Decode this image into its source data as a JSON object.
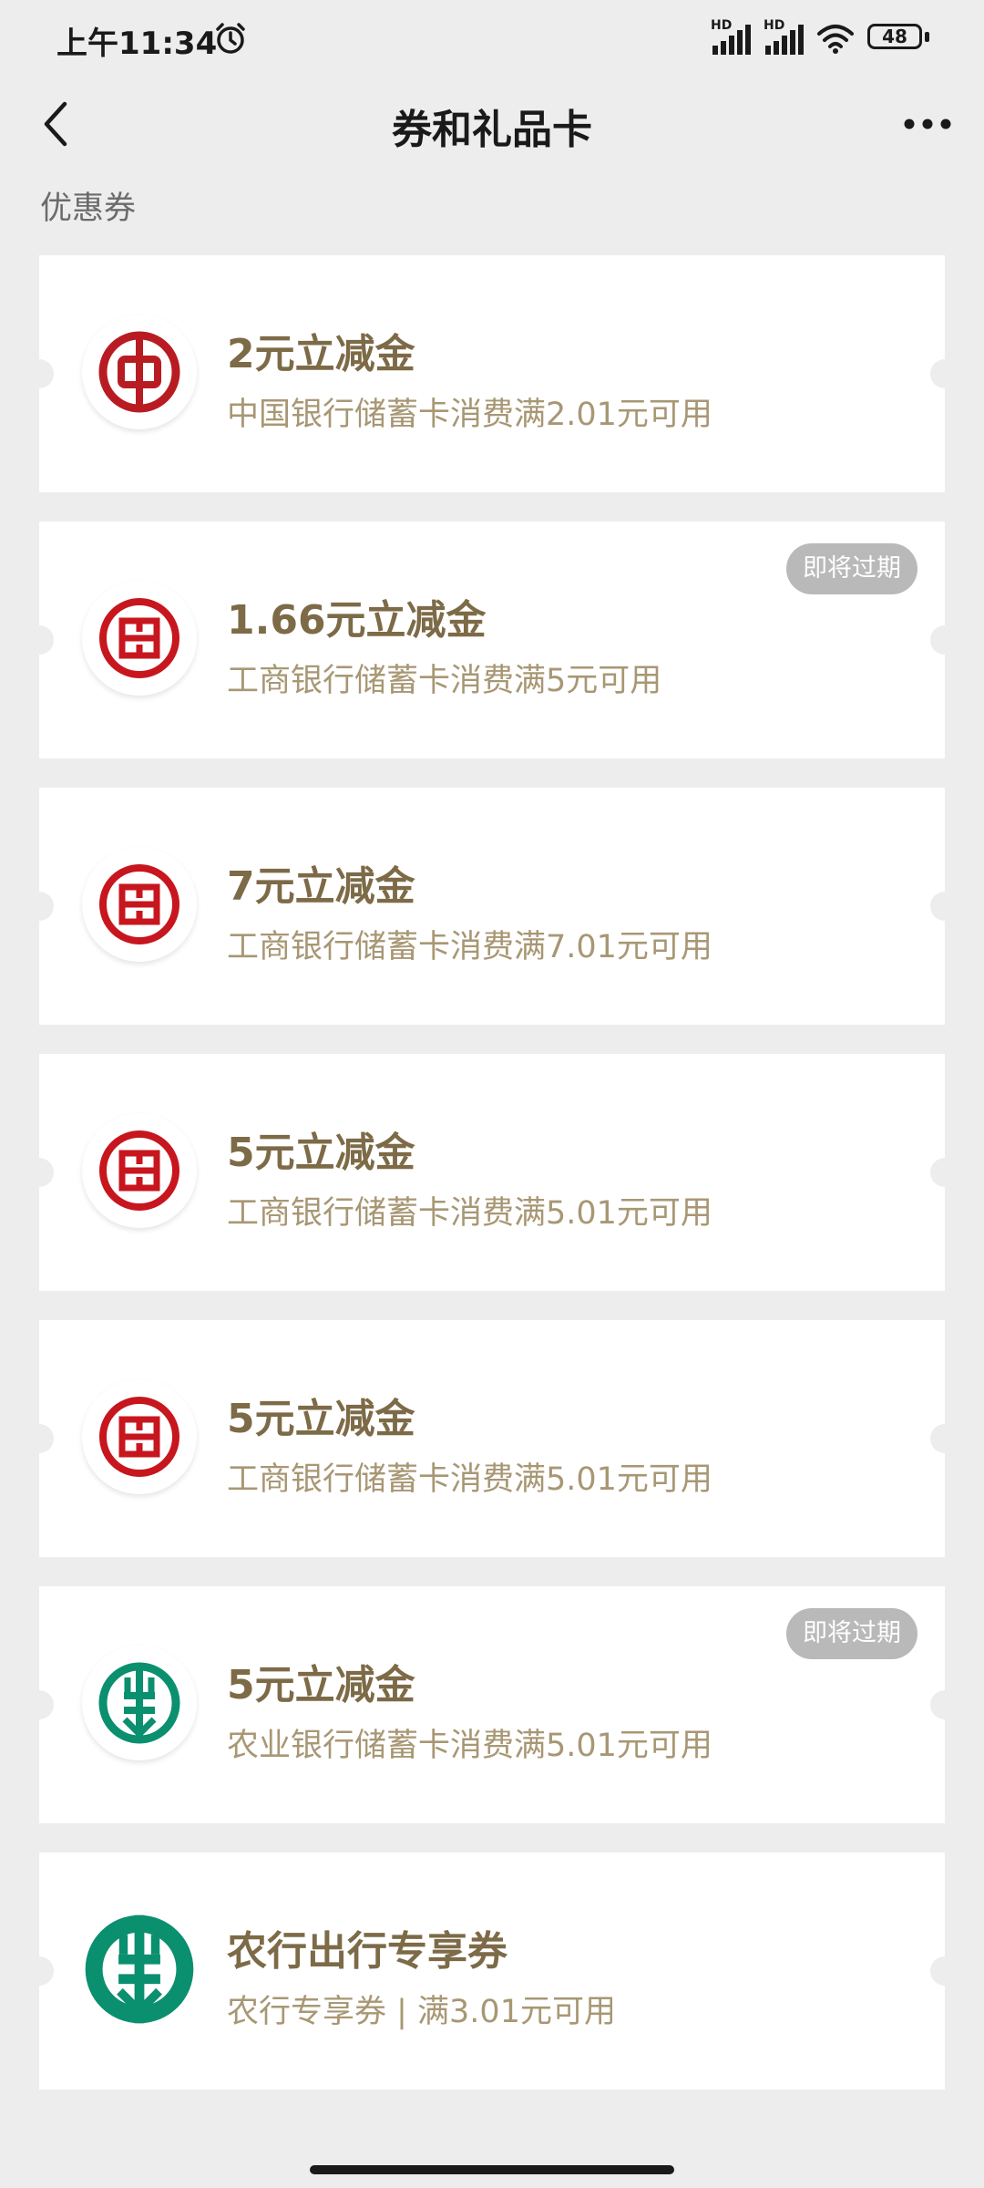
{
  "status_bar": {
    "time": "上午11:34",
    "battery": "48",
    "signal_labels": [
      "HD",
      "HD"
    ]
  },
  "nav": {
    "title": "券和礼品卡"
  },
  "section_label": "优惠券",
  "colors": {
    "boc_red": "#b81c22",
    "icbc_red": "#c7161e",
    "abc_green": "#0a8f6f",
    "gold_title": "#7d6a47",
    "gold_desc": "#a89774",
    "badge_gray": "#b9b9b9"
  },
  "coupons": [
    {
      "title": "2元立减金",
      "desc": "中国银行储蓄卡消费满2.01元可用",
      "bank_icon": "boc-logo-icon",
      "badge": ""
    },
    {
      "title": "1.66元立减金",
      "desc": "工商银行储蓄卡消费满5元可用",
      "bank_icon": "icbc-logo-icon",
      "badge": "即将过期"
    },
    {
      "title": "7元立减金",
      "desc": "工商银行储蓄卡消费满7.01元可用",
      "bank_icon": "icbc-logo-icon",
      "badge": ""
    },
    {
      "title": "5元立减金",
      "desc": "工商银行储蓄卡消费满5.01元可用",
      "bank_icon": "icbc-logo-icon",
      "badge": ""
    },
    {
      "title": "5元立减金",
      "desc": "工商银行储蓄卡消费满5.01元可用",
      "bank_icon": "icbc-logo-icon",
      "badge": ""
    },
    {
      "title": "5元立减金",
      "desc": "农业银行储蓄卡消费满5.01元可用",
      "bank_icon": "abc-logo-icon",
      "badge": "即将过期"
    },
    {
      "title": "农行出行专享券",
      "desc": "农行专享券 | 满3.01元可用",
      "bank_icon": "abc-logo-icon",
      "badge": ""
    }
  ]
}
